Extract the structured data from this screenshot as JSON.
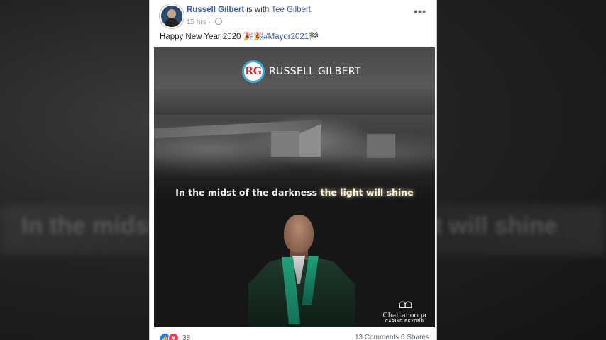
{
  "post": {
    "author": "Russell Gilbert",
    "with_text": "is with",
    "tagged": "Tee Gilbert",
    "time": "15 hrs",
    "more": "•••",
    "text": "Happy New Year 2020 🎉🎉",
    "hashtag": "#Mayor2021🏁"
  },
  "image": {
    "logo_initials": "RG",
    "logo_name": "RUSSELL GILBERT",
    "tagline_a": "In the midst of the darkness ",
    "tagline_b": "the light will shine",
    "sponsor_mark": "ᗝᗝ",
    "sponsor_name": "Chattanooga",
    "sponsor_sub": "CARING BEYOND"
  },
  "footer": {
    "reaction_count": "38",
    "comments": "13 Comments",
    "shares": "6 Shares",
    "like_icon": "👍",
    "love_icon": "♥"
  },
  "background": {
    "blurred_text": "In the midst of the darkness the light will shine"
  }
}
